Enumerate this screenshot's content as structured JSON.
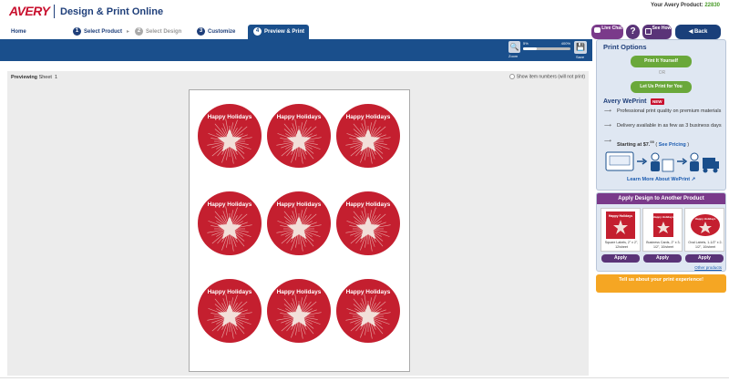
{
  "header": {
    "logo": "AVERY",
    "title": "Design & Print Online",
    "product_label": "Your Avery Product:",
    "product_number": "22830"
  },
  "nav": {
    "home": "Home",
    "steps": [
      {
        "num": "1",
        "label": "Select Product"
      },
      {
        "num": "2",
        "label": "Select Design"
      },
      {
        "num": "3",
        "label": "Customize"
      },
      {
        "num": "4",
        "label": "Preview & Print"
      }
    ]
  },
  "toolbar": {
    "live_chat": "Live Chat",
    "help": "?",
    "see_how": "See How",
    "back": "Back",
    "zoom_label": "Zoom",
    "zoom_min": "5%",
    "zoom_max": "400%",
    "zoom_level": 0.28,
    "save_label": "Save"
  },
  "canvas": {
    "previewing_label": "Previewing",
    "sheet_label": "Sheet",
    "sheet_number": "1",
    "show_item_numbers": "Show item numbers (will not print)",
    "label_text": "Happy Holidays",
    "label_color": "#c41f2f"
  },
  "sidebar": {
    "title": "Print Options",
    "print_yourself": "Print It Yourself",
    "or": "OR",
    "print_for_you": "Let Us Print for You",
    "weprint_title": "Avery WePrint",
    "new_badge": "NEW",
    "bullets": [
      "Professional print quality on premium materials",
      "Delivery available in as few as 3 business days"
    ],
    "starting_at": "Starting at $7.",
    "starting_cents": "00",
    "see_pricing": "See Pricing",
    "learn_more": "Learn More About WePrint"
  },
  "apply_panel": {
    "title": "Apply Design to Another Product",
    "products": [
      {
        "desc": "Square Labels, 2\" x 2\", 12/sheet",
        "thumb_text": "Happy Holidays"
      },
      {
        "desc": "Business Cards, 2\" x 3-1/2\", 10/sheet",
        "thumb_text": "Happy Holidays"
      },
      {
        "desc": "Oval Labels, 1-1/2\" x 2-1/2\", 10/sheet",
        "thumb_text": "Happy Holidays"
      }
    ],
    "apply": "Apply",
    "other_products": "Other products"
  },
  "feedback": {
    "text": "Tell us about your print experience!"
  }
}
